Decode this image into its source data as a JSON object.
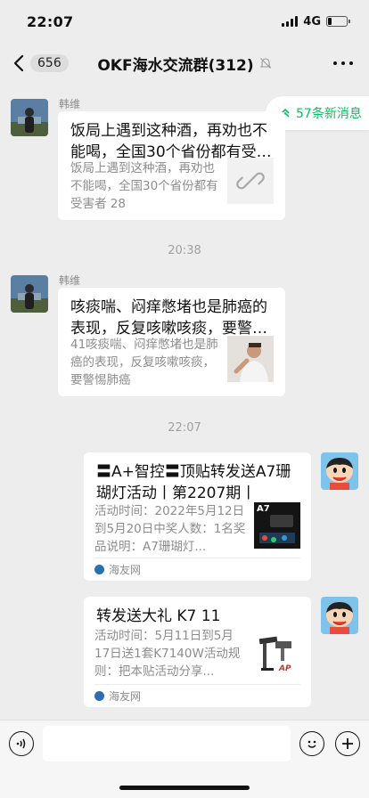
{
  "status": {
    "time": "22:07",
    "network": "4G",
    "battery_level": 0.2
  },
  "nav": {
    "unread_count": "656",
    "title": "OKF海水交流群(312)"
  },
  "new_messages": {
    "label": "57条新消息"
  },
  "messages": [
    {
      "sender": "韩维",
      "title": "饭局上遇到这种酒，再劝也不能喝，全国30个省份都有受害者",
      "desc": "饭局上遇到这种酒，再劝也不能喝，全国30个省份都有受害者 28",
      "thumb": "link-icon"
    },
    {
      "sender": "韩维",
      "title": "咳痰喘、闷痒憋堵也是肺癌的表现，反复咳嗽咳痰，要警惕肺癌",
      "desc": "41咳痰喘、闷痒憋堵也是肺癌的表现，反复咳嗽咳痰，要警惕肺癌",
      "thumb": "photo"
    },
    {
      "sender": "",
      "title": "〓A+智控〓顶贴转发送A7珊瑚灯活动丨第2207期丨",
      "desc": "活动时间：2022年5月12日到5月20日中奖人数：1名奖品说明：A7珊瑚灯...",
      "source": "海友网",
      "thumb_label": "A7"
    },
    {
      "sender": "",
      "title": "转发送大礼 K7 11",
      "desc": "活动时间：5月11日到5月17日送1套K7140W活动规则：把本贴活动分享...",
      "source": "海友网",
      "thumb_label": "AP"
    }
  ],
  "timestamps": [
    "20:38",
    "22:07"
  ],
  "colors": {
    "accent": "#07c160",
    "background": "#ededed"
  }
}
